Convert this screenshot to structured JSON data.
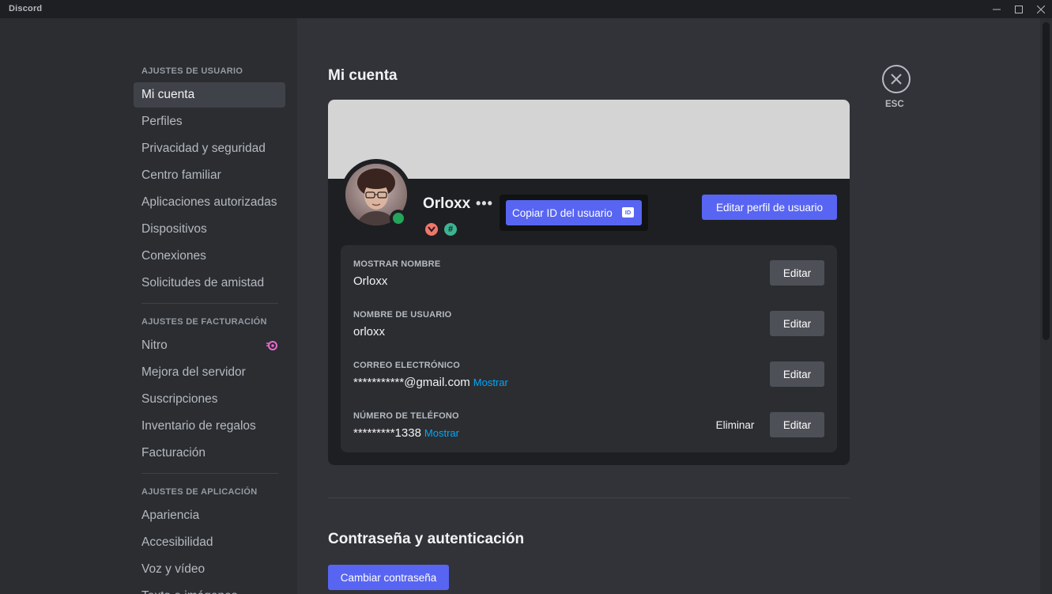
{
  "window": {
    "title": "Discord",
    "minimize": "—",
    "maximize": "☐",
    "close": "✕"
  },
  "sidebar": {
    "user_header": "AJUSTES DE USUARIO",
    "user_items": [
      "Mi cuenta",
      "Perfiles",
      "Privacidad y seguridad",
      "Centro familiar",
      "Aplicaciones autorizadas",
      "Dispositivos",
      "Conexiones",
      "Solicitudes de amistad"
    ],
    "billing_header": "AJUSTES DE FACTURACIÓN",
    "billing_items": [
      "Nitro",
      "Mejora del servidor",
      "Suscripciones",
      "Inventario de regalos",
      "Facturación"
    ],
    "app_header": "AJUSTES DE APLICACIÓN",
    "app_items": [
      "Apariencia",
      "Accesibilidad",
      "Voz y vídeo",
      "Texto e imágenes"
    ],
    "active_item": "Mi cuenta"
  },
  "main": {
    "title": "Mi cuenta",
    "esc_label": "ESC",
    "profile": {
      "username": "Orloxx",
      "more": "•••",
      "status": "online",
      "copy_id_label": "Copiar ID del usuario",
      "id_icon_text": "ID",
      "edit_profile_label": "Editar perfil de usuario",
      "badges": [
        "hypesquad-badge-icon",
        "hashtag-badge-icon"
      ]
    },
    "fields": [
      {
        "label": "MOSTRAR NOMBRE",
        "value": "Orloxx",
        "reveal": "",
        "edit": "Editar"
      },
      {
        "label": "NOMBRE DE USUARIO",
        "value": "orloxx",
        "reveal": "",
        "edit": "Editar"
      },
      {
        "label": "CORREO ELECTRÓNICO",
        "value": "***********@gmail.com",
        "reveal": "Mostrar",
        "edit": "Editar"
      },
      {
        "label": "NÚMERO DE TELÉFONO",
        "value": "*********1338",
        "reveal": "Mostrar",
        "edit": "Editar",
        "remove": "Eliminar"
      }
    ],
    "password_section": {
      "title": "Contraseña y autenticación",
      "change_password_label": "Cambiar contraseña"
    }
  },
  "colors": {
    "accent": "#5865f2",
    "online": "#23a55a",
    "link": "#00a8fc",
    "nitro": "#e86bd1"
  }
}
